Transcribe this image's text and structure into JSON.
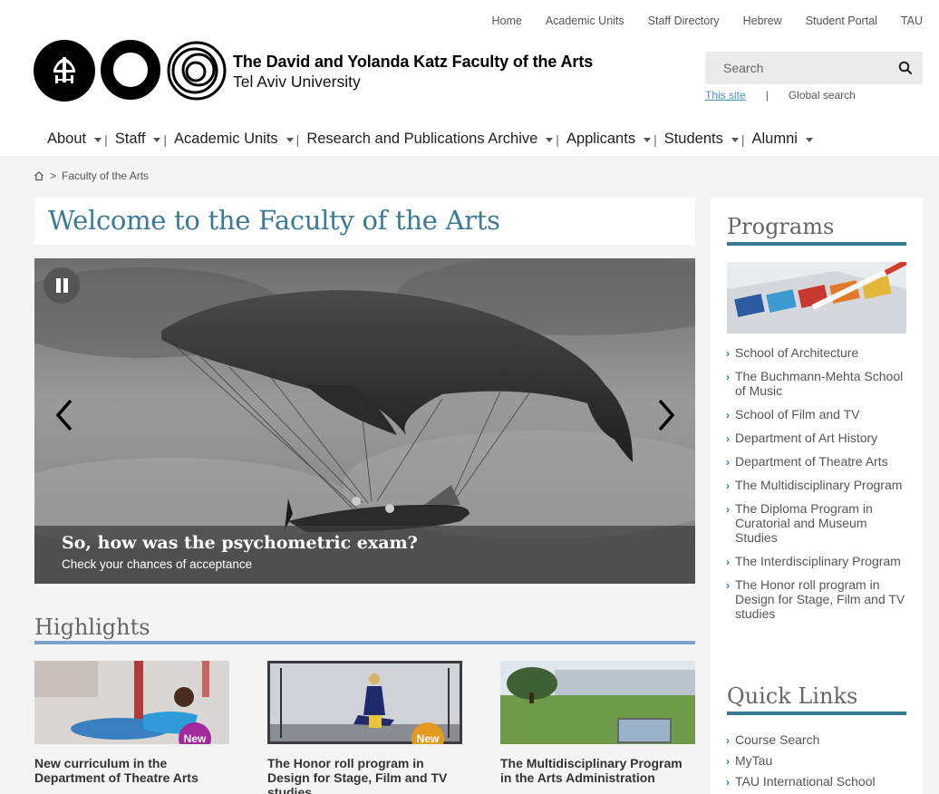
{
  "util_nav": [
    "Home",
    "Academic Units",
    "Staff Directory",
    "Hebrew",
    "Student Portal",
    "TAU"
  ],
  "brand": {
    "title": "The David and Yolanda Katz Faculty of the Arts",
    "subtitle": "Tel Aviv University"
  },
  "search": {
    "placeholder": "Search",
    "this_site": "This site",
    "separator": "|",
    "global": "Global search"
  },
  "main_nav": [
    {
      "label": "About",
      "sep": "|"
    },
    {
      "label": "Staff",
      "sep": "|"
    },
    {
      "label": "Academic Units",
      "sep": "|"
    },
    {
      "label": "Research and Publications Archive",
      "sep": "|"
    },
    {
      "label": "Applicants",
      "sep": "|"
    },
    {
      "label": "Students",
      "sep": "|"
    },
    {
      "label": "Alumni",
      "sep": ""
    }
  ],
  "breadcrumb": {
    "sep": ">",
    "current": "Faculty of the Arts"
  },
  "welcome_title": "Welcome to the Faculty of the Arts",
  "slider": {
    "caption_title": "So, how was the psychometric exam?",
    "caption_sub": "Check your chances of acceptance"
  },
  "highlights": {
    "title": "Highlights",
    "cards": [
      {
        "title": "New curriculum in the Department of Theatre Arts",
        "badge": "New",
        "badge_color": "#a3289b"
      },
      {
        "title": "The Honor roll program in Design for Stage, Film and TV studies",
        "badge": "New",
        "badge_color": "#e39a1e"
      },
      {
        "title": "The Multidisciplinary Program in the Arts Administration",
        "badge": "",
        "badge_color": ""
      }
    ]
  },
  "sidebar": {
    "programs_title": "Programs",
    "programs": [
      "School of Architecture",
      "The Buchmann-Mehta School of Music",
      "School of Film and TV",
      "Department of Art History",
      "Department of Theatre Arts",
      "The Multidisciplinary Program",
      "The Diploma Program in Curatorial and Museum Studies",
      "The Interdisciplinary Program",
      "The Honor roll program in Design for Stage, Film and TV studies"
    ],
    "quick_title": "Quick Links",
    "quick_links": [
      "Course Search",
      "MyTau",
      "TAU International School"
    ]
  },
  "colors": {
    "accent": "#3a7a96",
    "highlight_rule": "#7aa3cc"
  },
  "icons": [
    "search-icon",
    "home-icon",
    "pause-icon",
    "chevron-left-icon",
    "chevron-right-icon"
  ]
}
